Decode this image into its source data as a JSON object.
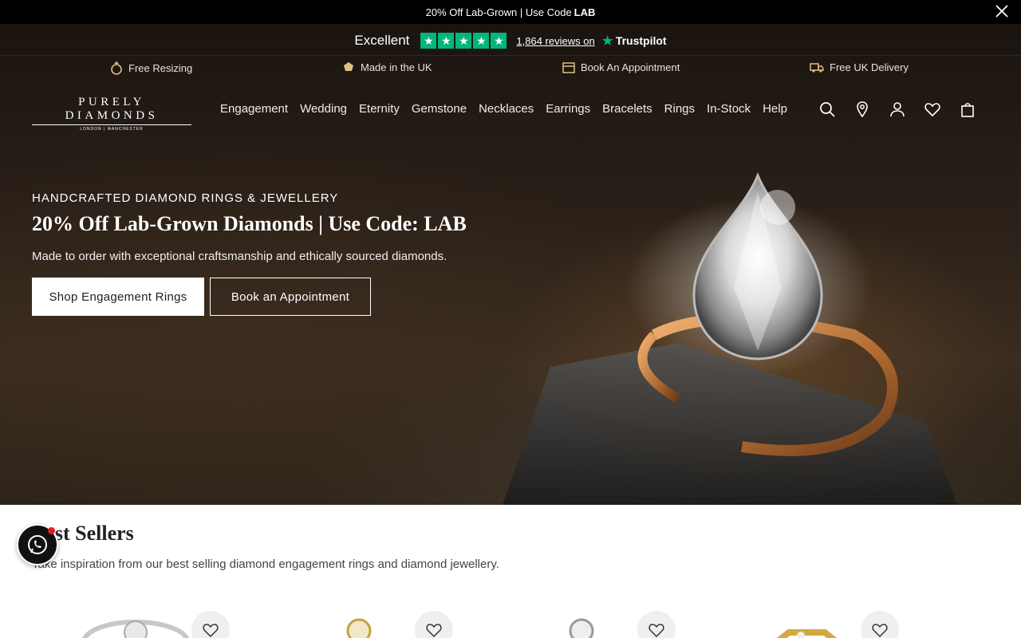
{
  "announcement": {
    "text": "20% Off Lab-Grown | Use Code",
    "code": "LAB"
  },
  "trustpilot": {
    "rating_word": "Excellent",
    "reviews": "1,864 reviews on",
    "brand": "Trustpilot",
    "stars": 5
  },
  "usps": [
    {
      "label": "Free Resizing",
      "icon": "ring-icon"
    },
    {
      "label": "Made in the UK",
      "icon": "uk-icon"
    },
    {
      "label": "Book An Appointment",
      "icon": "calendar-icon"
    },
    {
      "label": "Free UK Delivery",
      "icon": "delivery-icon"
    }
  ],
  "logo": {
    "text": "PURELY DIAMONDS",
    "subtext": "LONDON | MANCHESTER"
  },
  "nav": [
    "Engagement",
    "Wedding",
    "Eternity",
    "Gemstone",
    "Necklaces",
    "Earrings",
    "Bracelets",
    "Rings",
    "In-Stock",
    "Help"
  ],
  "hero": {
    "eyebrow": "HANDCRAFTED DIAMOND RINGS & JEWELLERY",
    "title": "20% Off Lab-Grown Diamonds | Use Code: LAB",
    "subtitle": "Made to order with exceptional craftsmanship and ethically sourced diamonds.",
    "primary_cta": "Shop Engagement Rings",
    "secondary_cta": "Book an Appointment"
  },
  "best_sellers": {
    "title": "Best Sellers",
    "subtitle": "Take inspiration from our best selling diamond engagement rings and diamond jewellery."
  },
  "colors": {
    "trustpilot_green": "#00b67a",
    "dark_bg": "#2a2018",
    "notification": "#e02020"
  }
}
